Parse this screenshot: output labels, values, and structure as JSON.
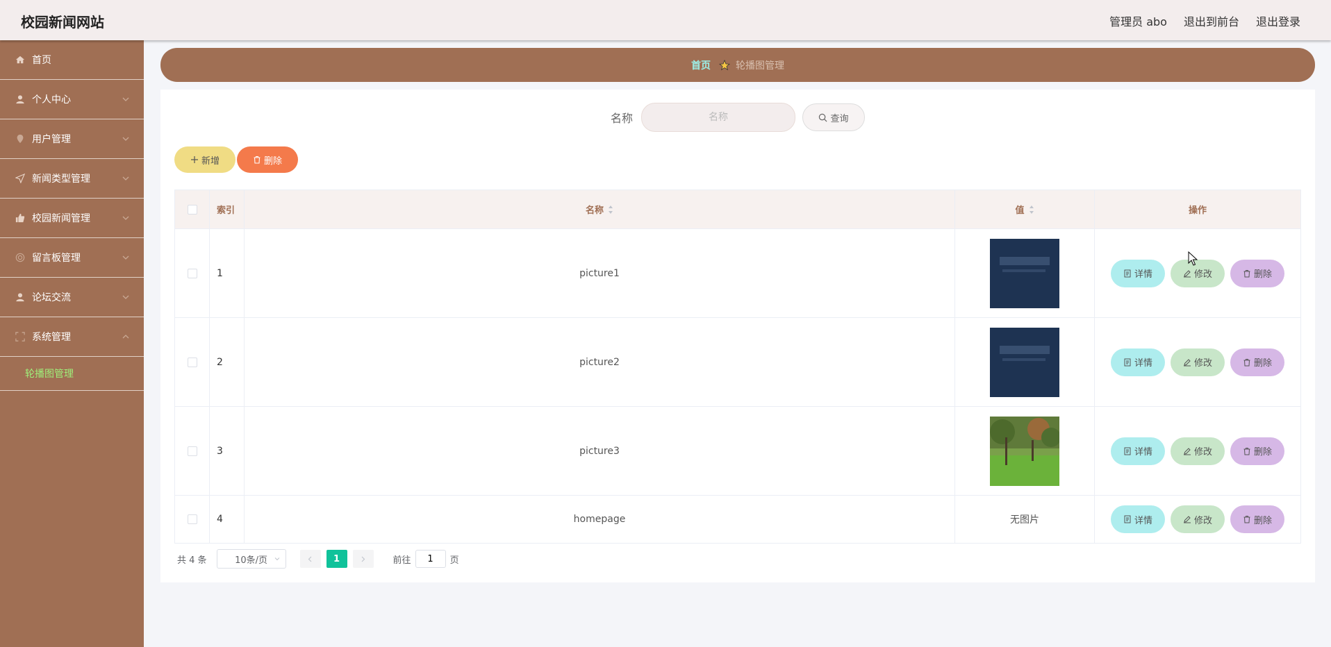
{
  "header": {
    "title": "校园新闻网站",
    "user": "管理员 abo",
    "to_front": "退出到前台",
    "logout": "退出登录"
  },
  "sidebar": {
    "items": [
      {
        "label": "首页",
        "icon": "home-icon"
      },
      {
        "label": "个人中心",
        "icon": "user-icon"
      },
      {
        "label": "用户管理",
        "icon": "location-icon"
      },
      {
        "label": "新闻类型管理",
        "icon": "send-icon"
      },
      {
        "label": "校园新闻管理",
        "icon": "thumb-icon"
      },
      {
        "label": "留言板管理",
        "icon": "help-icon"
      },
      {
        "label": "论坛交流",
        "icon": "user-icon"
      },
      {
        "label": "系统管理",
        "icon": "fullscreen-icon"
      }
    ],
    "submenu": "轮播图管理"
  },
  "breadcrumb": {
    "home": "首页",
    "current": "轮播图管理"
  },
  "search": {
    "label": "名称",
    "placeholder": "名称",
    "button": "查询"
  },
  "toolbar": {
    "add": "新增",
    "delete": "删除"
  },
  "table": {
    "headers": {
      "index": "索引",
      "name": "名称",
      "value": "值",
      "ops": "操作"
    },
    "rows": [
      {
        "index": "1",
        "name": "picture1",
        "value": "",
        "image": "dark-banner"
      },
      {
        "index": "2",
        "name": "picture2",
        "value": "",
        "image": "dark-banner"
      },
      {
        "index": "3",
        "name": "picture3",
        "value": "",
        "image": "campus-lawn"
      },
      {
        "index": "4",
        "name": "homepage",
        "value": "无图片",
        "image": ""
      }
    ],
    "ops": {
      "detail": "详情",
      "edit": "修改",
      "delete": "删除"
    }
  },
  "pagination": {
    "total": "共 4 条",
    "page_size": "10条/页",
    "current": "1",
    "goto_prefix": "前往",
    "goto_value": "1",
    "goto_suffix": "页"
  },
  "colors": {
    "sidebar": "#a06f54",
    "accent": "#10c29a",
    "submenu_active": "#9ff07a"
  }
}
